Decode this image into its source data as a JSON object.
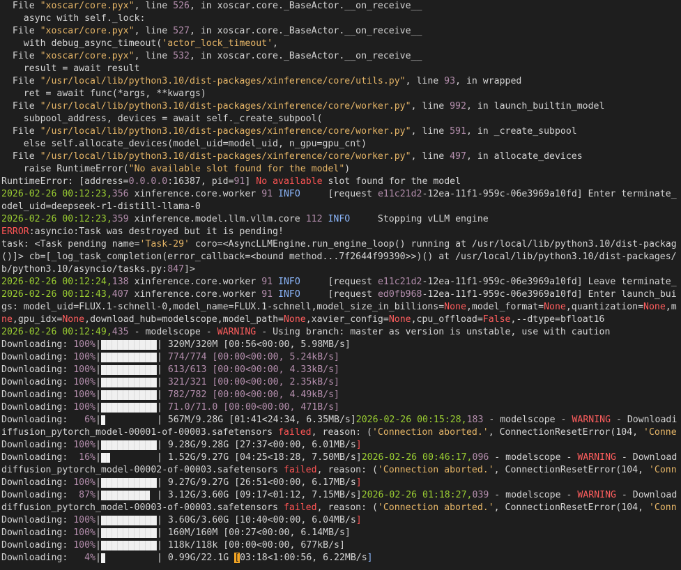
{
  "colors": {
    "background": "#1e1e1e",
    "text": "#d4d4d4",
    "string": "#e5b567",
    "number": "#b48ead",
    "error": "#ff5555",
    "info": "#8ab4f8",
    "timestamp": "#9acd32",
    "bar": "#f0f0f0",
    "cursor": "#f5a623"
  },
  "lines": [
    {
      "spans": [
        {
          "t": "  File "
        },
        {
          "t": "\"xoscar/core.pyx\"",
          "c": "s-str"
        },
        {
          "t": ", line "
        },
        {
          "t": "526",
          "c": "s-num"
        },
        {
          "t": ", in xoscar.core._BaseActor.__on_receive__"
        }
      ]
    },
    {
      "spans": [
        {
          "t": "    async with self._lock:"
        }
      ]
    },
    {
      "spans": [
        {
          "t": "  File "
        },
        {
          "t": "\"xoscar/core.pyx\"",
          "c": "s-str"
        },
        {
          "t": ", line "
        },
        {
          "t": "527",
          "c": "s-num"
        },
        {
          "t": ", in xoscar.core._BaseActor.__on_receive__"
        }
      ]
    },
    {
      "spans": [
        {
          "t": "    with debug_async_timeout("
        },
        {
          "t": "'actor_lock_timeout'",
          "c": "s-str"
        },
        {
          "t": ","
        }
      ]
    },
    {
      "spans": [
        {
          "t": "  File "
        },
        {
          "t": "\"xoscar/core.pyx\"",
          "c": "s-str"
        },
        {
          "t": ", line "
        },
        {
          "t": "532",
          "c": "s-num"
        },
        {
          "t": ", in xoscar.core._BaseActor.__on_receive__"
        }
      ]
    },
    {
      "spans": [
        {
          "t": "    result = await result"
        }
      ]
    },
    {
      "spans": [
        {
          "t": "  File "
        },
        {
          "t": "\"/usr/local/lib/python3.10/dist-packages/xinference/core/utils.py\"",
          "c": "s-str"
        },
        {
          "t": ", line "
        },
        {
          "t": "93",
          "c": "s-num"
        },
        {
          "t": ", in wrapped"
        }
      ]
    },
    {
      "spans": [
        {
          "t": "    ret = await func(*args, **kwargs)"
        }
      ]
    },
    {
      "spans": [
        {
          "t": "  File "
        },
        {
          "t": "\"/usr/local/lib/python3.10/dist-packages/xinference/core/worker.py\"",
          "c": "s-str"
        },
        {
          "t": ", line "
        },
        {
          "t": "992",
          "c": "s-num"
        },
        {
          "t": ", in launch_builtin_model"
        }
      ]
    },
    {
      "spans": [
        {
          "t": "    subpool_address, devices = await self._create_subpool("
        }
      ]
    },
    {
      "spans": [
        {
          "t": "  File "
        },
        {
          "t": "\"/usr/local/lib/python3.10/dist-packages/xinference/core/worker.py\"",
          "c": "s-str"
        },
        {
          "t": ", line "
        },
        {
          "t": "591",
          "c": "s-num"
        },
        {
          "t": ", in _create_subpool"
        }
      ]
    },
    {
      "spans": [
        {
          "t": "    else self.allocate_devices(model_uid=model_uid, n_gpu=gpu_cnt)"
        }
      ]
    },
    {
      "spans": [
        {
          "t": "  File "
        },
        {
          "t": "\"/usr/local/lib/python3.10/dist-packages/xinference/core/worker.py\"",
          "c": "s-str"
        },
        {
          "t": ", line "
        },
        {
          "t": "497",
          "c": "s-num"
        },
        {
          "t": ", in allocate_devices"
        }
      ]
    },
    {
      "spans": [
        {
          "t": "    raise RuntimeError("
        },
        {
          "t": "\"No available slot found for the model\"",
          "c": "s-str"
        },
        {
          "t": ")"
        }
      ]
    },
    {
      "spans": [
        {
          "t": "RuntimeError: [address="
        },
        {
          "t": "0.0.0.0",
          "c": "s-num"
        },
        {
          "t": ":16387, pid="
        },
        {
          "t": "91",
          "c": "s-num"
        },
        {
          "t": "] "
        },
        {
          "t": "No available",
          "c": "s-err"
        },
        {
          "t": " slot found for the model"
        }
      ]
    },
    {
      "spans": [
        {
          "t": "2026-02-26 00:12:23,",
          "c": "s-ts"
        },
        {
          "t": "356",
          "c": "s-num"
        },
        {
          "t": " xinference.core.worker "
        },
        {
          "t": "91",
          "c": "s-num"
        },
        {
          "t": " INFO",
          "c": "s-info"
        },
        {
          "t": "     [request "
        },
        {
          "t": "e11c21d2",
          "c": "s-num"
        },
        {
          "t": "-12ea-11f1-959c-06e3969a10fd] Enter terminate_"
        }
      ]
    },
    {
      "spans": [
        {
          "t": "odel_uid=deepseek-r1-distill-llama-0"
        }
      ]
    },
    {
      "spans": [
        {
          "t": "2026-02-26 00:12:23,",
          "c": "s-ts"
        },
        {
          "t": "359",
          "c": "s-num"
        },
        {
          "t": " xinference.model.llm.vllm.core "
        },
        {
          "t": "112",
          "c": "s-num"
        },
        {
          "t": " INFO",
          "c": "s-info"
        },
        {
          "t": "     Stopping vLLM engine"
        }
      ]
    },
    {
      "spans": [
        {
          "t": "ERROR",
          "c": "s-err"
        },
        {
          "t": ":asyncio:Task was destroyed but it is pending!"
        }
      ]
    },
    {
      "spans": [
        {
          "t": "task: <Task pending name="
        },
        {
          "t": "'Task-29'",
          "c": "s-str"
        },
        {
          "t": " coro=<AsyncLLMEngine.run_engine_loop() running at /usr/local/lib/python3.10/dist-packag"
        }
      ]
    },
    {
      "spans": [
        {
          "t": "()]> cb=[_log_task_completion(error_callback=<bound method...7f2644f99390>>)() at /usr/local/lib/python3.10/dist-packages/"
        }
      ]
    },
    {
      "spans": [
        {
          "t": "b/python3.10/asyncio/tasks.py:"
        },
        {
          "t": "847",
          "c": "s-num"
        },
        {
          "t": "]>"
        }
      ]
    },
    {
      "spans": [
        {
          "t": "2026-02-26 00:12:24,",
          "c": "s-ts"
        },
        {
          "t": "138",
          "c": "s-num"
        },
        {
          "t": " xinference.core.worker "
        },
        {
          "t": "91",
          "c": "s-num"
        },
        {
          "t": " INFO",
          "c": "s-info"
        },
        {
          "t": "     [request "
        },
        {
          "t": "e11c21d2",
          "c": "s-num"
        },
        {
          "t": "-12ea-11f1-959c-06e3969a10fd] Leave terminate_"
        }
      ]
    },
    {
      "spans": [
        {
          "t": "2026-02-26 00:12:43,",
          "c": "s-ts"
        },
        {
          "t": "407",
          "c": "s-num"
        },
        {
          "t": " xinference.core.worker "
        },
        {
          "t": "91",
          "c": "s-num"
        },
        {
          "t": " INFO",
          "c": "s-info"
        },
        {
          "t": "     [request "
        },
        {
          "t": "ed0fb968",
          "c": "s-num"
        },
        {
          "t": "-12ea-11f1-959c-06e3969a10fd] Enter launch_bui"
        }
      ]
    },
    {
      "spans": [
        {
          "t": "gs: model_uid=FLUX.1-schnell-0,model_name=FLUX.1-schnell,model_size_in_billions="
        },
        {
          "t": "None",
          "c": "s-warn"
        },
        {
          "t": ",model_format="
        },
        {
          "t": "None",
          "c": "s-warn"
        },
        {
          "t": ",quantization="
        },
        {
          "t": "None",
          "c": "s-warn"
        },
        {
          "t": ",m"
        }
      ]
    },
    {
      "spans": [
        {
          "t": "ne",
          "c": "s-warn"
        },
        {
          "t": ",gpu_idx="
        },
        {
          "t": "None",
          "c": "s-warn"
        },
        {
          "t": ",download_hub=modelscope,model_path="
        },
        {
          "t": "None",
          "c": "s-warn"
        },
        {
          "t": ",xavier_config="
        },
        {
          "t": "None",
          "c": "s-warn"
        },
        {
          "t": ",cpu_offload="
        },
        {
          "t": "False",
          "c": "s-warn"
        },
        {
          "t": ",--dtype=bfloat16"
        }
      ]
    },
    {
      "spans": [
        {
          "t": "2026-02-26 00:12:49,",
          "c": "s-ts"
        },
        {
          "t": "435",
          "c": "s-num"
        },
        {
          "t": " - modelscope - "
        },
        {
          "t": "WARNING",
          "c": "s-warn"
        },
        {
          "t": " - Using branch: master as version is unstable, use with caution"
        }
      ]
    },
    {
      "spans": [
        {
          "t": "Downloading: "
        },
        {
          "t": "100%",
          "c": "s-num"
        },
        {
          "t": "|"
        },
        {
          "bar": 1
        },
        {
          "t": "| "
        },
        {
          "t": "320M/320M [00:56<00:00, 5.98MB/s]",
          "c": ""
        }
      ]
    },
    {
      "spans": [
        {
          "t": "Downloading: "
        },
        {
          "t": "100%",
          "c": "s-num"
        },
        {
          "t": "|"
        },
        {
          "bar": 1
        },
        {
          "t": "| "
        },
        {
          "t": "774/774",
          "c": "s-num"
        },
        {
          "t": " [00:00<00:00, 5.24kB/s]",
          "c": "s-num"
        }
      ]
    },
    {
      "spans": [
        {
          "t": "Downloading: "
        },
        {
          "t": "100%",
          "c": "s-num"
        },
        {
          "t": "|"
        },
        {
          "bar": 1
        },
        {
          "t": "| "
        },
        {
          "t": "613/613 [00:00<00:00, 4.33kB/s]",
          "c": "s-num"
        }
      ]
    },
    {
      "spans": [
        {
          "t": "Downloading: "
        },
        {
          "t": "100%",
          "c": "s-num"
        },
        {
          "t": "|"
        },
        {
          "bar": 1
        },
        {
          "t": "| "
        },
        {
          "t": "321/321 [00:00<00:00, 2.35kB/s]",
          "c": "s-num"
        }
      ]
    },
    {
      "spans": [
        {
          "t": "Downloading: "
        },
        {
          "t": "100%",
          "c": "s-num"
        },
        {
          "t": "|"
        },
        {
          "bar": 1
        },
        {
          "t": "| "
        },
        {
          "t": "782/782 [00:00<00:00, 4.49kB/s]",
          "c": "s-num"
        }
      ]
    },
    {
      "spans": [
        {
          "t": "Downloading: "
        },
        {
          "t": "100%",
          "c": "s-num"
        },
        {
          "t": "|"
        },
        {
          "bar": 1
        },
        {
          "t": "| "
        },
        {
          "t": "71.0/71.0 [00:00<00:00, 471B/s]",
          "c": "s-num"
        }
      ]
    },
    {
      "spans": [
        {
          "t": "Downloading:   "
        },
        {
          "t": "6%",
          "c": "s-num"
        },
        {
          "t": "|"
        },
        {
          "bar": 0.06
        },
        {
          "t": "| 567M/9.28G [01:41<24:34, 6.35MB/s]"
        },
        {
          "t": "2026-02-26 00:15:28,",
          "c": "s-ts"
        },
        {
          "t": "183",
          "c": "s-num"
        },
        {
          "t": " - modelscope - "
        },
        {
          "t": "WARNING",
          "c": "s-warn"
        },
        {
          "t": " - Downloadi"
        }
      ]
    },
    {
      "spans": [
        {
          "t": "iffusion_pytorch_model-00001-of-00003.safetensors "
        },
        {
          "t": "failed",
          "c": "s-err"
        },
        {
          "t": ", reason: ("
        },
        {
          "t": "'Connection aborted.'",
          "c": "s-str"
        },
        {
          "t": ", ConnectionResetError(104, "
        },
        {
          "t": "'Conne",
          "c": "s-str"
        }
      ]
    },
    {
      "spans": [
        {
          "t": "Downloading: "
        },
        {
          "t": "100%",
          "c": "s-num"
        },
        {
          "t": "|"
        },
        {
          "bar": 1
        },
        {
          "t": "| 9.28G/9.28G [27:37<00:00, 6.01MB/s"
        },
        {
          "t": "]",
          "c": "s-err"
        }
      ]
    },
    {
      "spans": [
        {
          "t": "Downloading:  "
        },
        {
          "t": "16%",
          "c": "s-num"
        },
        {
          "t": "|"
        },
        {
          "bar": 0.16
        },
        {
          "t": "| 1.52G/9.27G [04:25<18:28, 7.50MB/s]"
        },
        {
          "t": "2026-02-26 00:46:17,",
          "c": "s-ts"
        },
        {
          "t": "096",
          "c": "s-num"
        },
        {
          "t": " - modelscope - "
        },
        {
          "t": "WARNING",
          "c": "s-warn"
        },
        {
          "t": " - Download"
        }
      ]
    },
    {
      "spans": [
        {
          "t": "diffusion_pytorch_model-00002-of-00003.safetensors "
        },
        {
          "t": "failed",
          "c": "s-err"
        },
        {
          "t": ", reason: ("
        },
        {
          "t": "'Connection aborted.'",
          "c": "s-str"
        },
        {
          "t": ", ConnectionResetError(104, "
        },
        {
          "t": "'Conn",
          "c": "s-str"
        }
      ]
    },
    {
      "spans": [
        {
          "t": "Downloading: "
        },
        {
          "t": "100%",
          "c": "s-num"
        },
        {
          "t": "|"
        },
        {
          "bar": 1
        },
        {
          "t": "| 9.27G/9.27G [26:51<00:00, 6.17MB/s"
        },
        {
          "t": "]",
          "c": "s-err"
        }
      ]
    },
    {
      "spans": [
        {
          "t": "Downloading:  "
        },
        {
          "t": "87%",
          "c": "s-num"
        },
        {
          "t": "|"
        },
        {
          "bar": 0.87
        },
        {
          "t": "| 3.12G/3.60G [09:17<01:12, 7.15MB/s]"
        },
        {
          "t": "2026-02-26 01:18:27,",
          "c": "s-ts"
        },
        {
          "t": "039",
          "c": "s-num"
        },
        {
          "t": " - modelscope - "
        },
        {
          "t": "WARNING",
          "c": "s-warn"
        },
        {
          "t": " - Download"
        }
      ]
    },
    {
      "spans": [
        {
          "t": "diffusion_pytorch_model-00003-of-00003.safetensors "
        },
        {
          "t": "failed",
          "c": "s-err"
        },
        {
          "t": ", reason: ("
        },
        {
          "t": "'Connection aborted.'",
          "c": "s-str"
        },
        {
          "t": ", ConnectionResetError(104, "
        },
        {
          "t": "'Conn",
          "c": "s-str"
        }
      ]
    },
    {
      "spans": [
        {
          "t": "Downloading: "
        },
        {
          "t": "100%",
          "c": "s-num"
        },
        {
          "t": "|"
        },
        {
          "bar": 1
        },
        {
          "t": "| 3.60G/3.60G [10:40<00:00, 6.04MB/s"
        },
        {
          "t": "]",
          "c": "s-err"
        }
      ]
    },
    {
      "spans": [
        {
          "t": "Downloading: "
        },
        {
          "t": "100%",
          "c": "s-num"
        },
        {
          "t": "|"
        },
        {
          "bar": 1
        },
        {
          "t": "| 160M/160M [00:27<00:00, 6.14MB/s]"
        }
      ]
    },
    {
      "spans": [
        {
          "t": "Downloading: "
        },
        {
          "t": "100%",
          "c": "s-num"
        },
        {
          "t": "|"
        },
        {
          "bar": 1
        },
        {
          "t": "| 118k/118k [00:00<00:00, 677kB/s]"
        }
      ]
    },
    {
      "spans": [
        {
          "t": "Downloading:   "
        },
        {
          "t": "4%",
          "c": "s-num"
        },
        {
          "t": "|"
        },
        {
          "bar": 0.04
        },
        {
          "t": "| 0.99G/22.1G "
        },
        {
          "t": "[",
          "c": "cursor"
        },
        {
          "t": "03:18<1:00:56, 6.22MB/s"
        },
        {
          "t": "]",
          "c": "s-info"
        }
      ]
    }
  ]
}
